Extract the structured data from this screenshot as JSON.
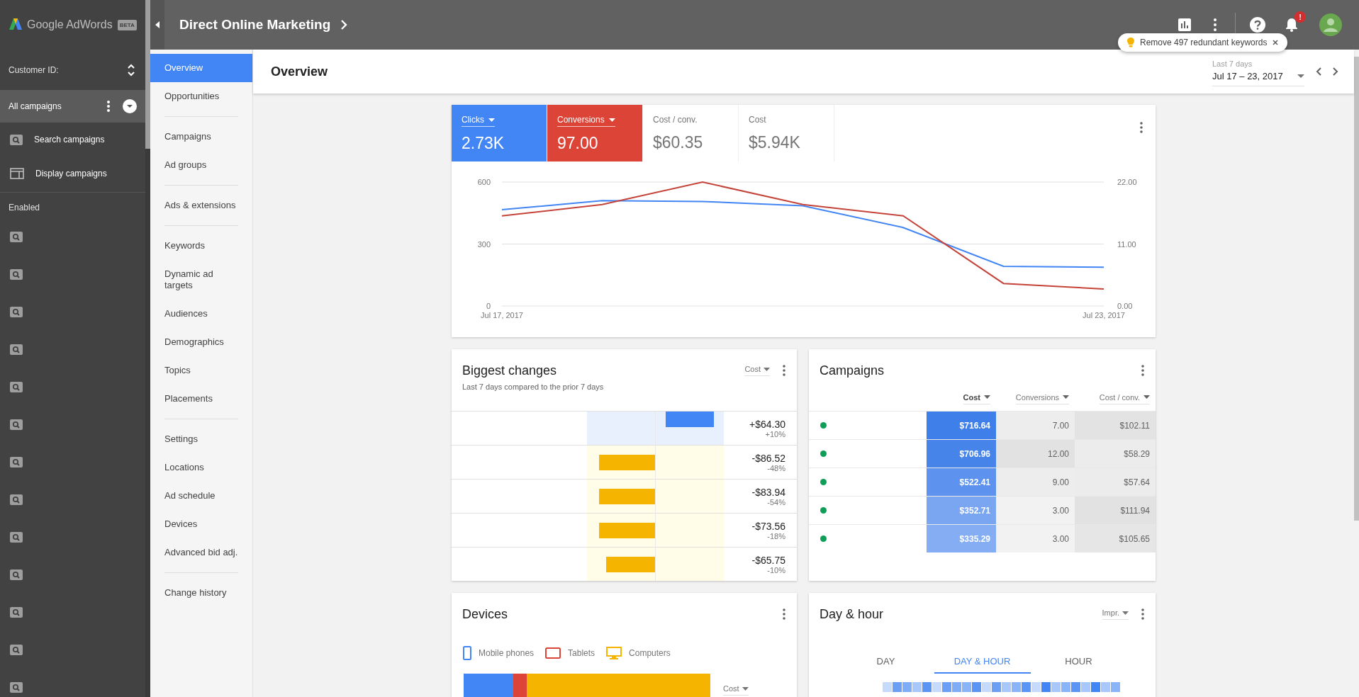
{
  "sidebar": {
    "logo_text": "Google AdWords",
    "beta_badge": "BETA",
    "customer_id_label": "Customer ID:",
    "all_campaigns": {
      "label": "All campaigns",
      "selected": true
    },
    "campaign_types": [
      {
        "label": "Search campaigns",
        "kind": "search"
      },
      {
        "label": "Display campaigns",
        "kind": "display"
      }
    ],
    "section_label": "Enabled",
    "enabled_campaigns": [
      {
        "kind": "search"
      },
      {
        "kind": "search"
      },
      {
        "kind": "search"
      },
      {
        "kind": "search"
      },
      {
        "kind": "search"
      },
      {
        "kind": "search"
      },
      {
        "kind": "search"
      },
      {
        "kind": "search"
      },
      {
        "kind": "search"
      },
      {
        "kind": "search"
      },
      {
        "kind": "search"
      },
      {
        "kind": "search"
      },
      {
        "kind": "search"
      }
    ]
  },
  "header": {
    "title": "Direct Online Marketing",
    "notification_badge": "!"
  },
  "tip": {
    "text": "Remove 497 redundant keywords"
  },
  "nav": {
    "groups": [
      {
        "items": [
          {
            "label": "Overview",
            "selected": true
          },
          {
            "label": "Opportunities",
            "selected": false
          }
        ]
      },
      {
        "items": [
          {
            "label": "Campaigns",
            "selected": false
          },
          {
            "label": "Ad groups",
            "selected": false
          }
        ]
      },
      {
        "items": [
          {
            "label": "Ads & extensions",
            "selected": false
          }
        ]
      },
      {
        "items": [
          {
            "label": "Keywords",
            "selected": false
          },
          {
            "label": "Dynamic ad targets",
            "selected": false
          },
          {
            "label": "Audiences",
            "selected": false
          },
          {
            "label": "Demographics",
            "selected": false
          },
          {
            "label": "Topics",
            "selected": false
          },
          {
            "label": "Placements",
            "selected": false
          }
        ]
      },
      {
        "items": [
          {
            "label": "Settings",
            "selected": false
          },
          {
            "label": "Locations",
            "selected": false
          },
          {
            "label": "Ad schedule",
            "selected": false
          },
          {
            "label": "Devices",
            "selected": false
          },
          {
            "label": "Advanced bid adj.",
            "selected": false
          }
        ]
      },
      {
        "items": [
          {
            "label": "Change history",
            "selected": false
          }
        ]
      }
    ]
  },
  "page": {
    "title": "Overview",
    "date_range": {
      "label": "Last 7 days",
      "value": "Jul 17 – 23, 2017"
    }
  },
  "performance": {
    "tiles": [
      {
        "label": "Clicks",
        "value": "2.73K",
        "selected": true,
        "color": "#4285f4"
      },
      {
        "label": "Conversions",
        "value": "97.00",
        "selected": true,
        "color": "#db4437"
      },
      {
        "label": "Cost / conv.",
        "value": "$60.35",
        "selected": false
      },
      {
        "label": "Cost",
        "value": "$5.94K",
        "selected": false
      }
    ],
    "chart_data": {
      "type": "line",
      "categories": [
        "Jul 17, 2017",
        null,
        null,
        null,
        null,
        null,
        "Jul 23, 2017"
      ],
      "ylim": [
        0,
        600
      ],
      "yticks": [
        0,
        300,
        600
      ],
      "y2lim": [
        0,
        22
      ],
      "y2ticks": [
        {
          "value": 0,
          "label": "0.00"
        },
        {
          "value": 11,
          "label": "11.00"
        },
        {
          "value": 22,
          "label": "22.00"
        }
      ],
      "series": [
        {
          "color": "#4285f4",
          "axis": "y",
          "values": [
            466,
            510,
            506,
            485,
            380,
            192,
            188
          ]
        },
        {
          "color": "#c5443a",
          "axis": "y2",
          "values": [
            16,
            18,
            22,
            18,
            16,
            4,
            3
          ]
        }
      ]
    }
  },
  "biggest_changes": {
    "title": "Biggest changes",
    "subtitle": "Last 7 days compared to the prior 7 days",
    "metric": "Cost",
    "rows": [
      {
        "kind": "increase",
        "level": 0.7,
        "change": "+$64.30",
        "percent": "+10%"
      },
      {
        "kind": "decrease",
        "level": 0.82,
        "change": "-$86.52",
        "percent": "-48%"
      },
      {
        "kind": "decrease",
        "level": 0.82,
        "change": "-$83.94",
        "percent": "-54%"
      },
      {
        "kind": "decrease",
        "level": 0.82,
        "change": "-$73.56",
        "percent": "-18%"
      },
      {
        "kind": "decrease",
        "level": 0.72,
        "change": "-$65.75",
        "percent": "-10%"
      }
    ]
  },
  "campaigns": {
    "title": "Campaigns",
    "columns": [
      {
        "label": "Cost",
        "sorted": true
      },
      {
        "label": "Conversions",
        "sorted": false
      },
      {
        "label": "Cost / conv.",
        "sorted": false
      }
    ],
    "rows": [
      {
        "color": "#0f9d58",
        "cells": [
          {
            "text": "$716.64",
            "color": "#3f7fe9"
          },
          {
            "text": "7.00",
            "color": "#ededed"
          },
          {
            "text": "$102.11",
            "color": "#e3e3e3"
          }
        ]
      },
      {
        "color": "#0f9d58",
        "cells": [
          {
            "text": "$706.96",
            "color": "#4784ea"
          },
          {
            "text": "12.00",
            "color": "#e2e2e2"
          },
          {
            "text": "$58.29",
            "color": "#ececec"
          }
        ]
      },
      {
        "color": "#0f9d58",
        "cells": [
          {
            "text": "$522.41",
            "color": "#5d93ee"
          },
          {
            "text": "9.00",
            "color": "#ededed"
          },
          {
            "text": "$57.64",
            "color": "#ececec"
          }
        ]
      },
      {
        "color": "#0f9d58",
        "cells": [
          {
            "text": "$352.71",
            "color": "#79a5f1"
          },
          {
            "text": "3.00",
            "color": "#f2f2f2"
          },
          {
            "text": "$111.94",
            "color": "#e2e2e2"
          }
        ]
      },
      {
        "color": "#0f9d58",
        "cells": [
          {
            "text": "$335.29",
            "color": "#84adf3"
          },
          {
            "text": "3.00",
            "color": "#f2f2f2"
          },
          {
            "text": "$105.65",
            "color": "#e6e6e6"
          }
        ]
      }
    ]
  },
  "devices": {
    "title": "Devices",
    "metric": "Cost",
    "items": [
      {
        "label": "Mobile phones",
        "kind": "phone",
        "color": "#4285f4"
      },
      {
        "label": "Tablets",
        "kind": "tablet",
        "color": "#db4437"
      },
      {
        "label": "Computers",
        "kind": "computer",
        "color": "#f4b400"
      }
    ]
  },
  "day_hour": {
    "title": "Day & hour",
    "metric": "Impr.",
    "tabs": [
      {
        "label": "DAY",
        "selected": false
      },
      {
        "label": "DAY & HOUR",
        "selected": true
      },
      {
        "label": "HOUR",
        "selected": false
      }
    ]
  }
}
